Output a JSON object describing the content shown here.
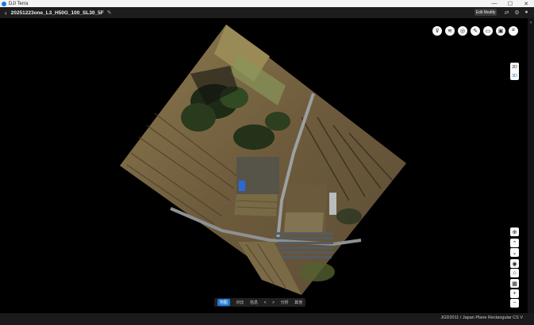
{
  "app": {
    "title": "DJI Terra"
  },
  "window": {
    "minimize": "—",
    "maximize": "☐",
    "close": "✕"
  },
  "project": {
    "name": "20251223one_L3_H50G_100_SL30_5F"
  },
  "header": {
    "edit_button": "Edit Modify"
  },
  "toolbar_icons": [
    "filter-icon",
    "layers-icon",
    "target-icon",
    "pen-icon",
    "ruler-icon",
    "cube-icon",
    "scan-icon"
  ],
  "dim_toggle": {
    "label_2d": "2D",
    "label_3d": "3D"
  },
  "bottom_tabs": [
    {
      "label": "地图",
      "active": true
    },
    {
      "label": "对比",
      "active": false
    },
    {
      "label": "信息",
      "active": false
    },
    {
      "label": "<",
      "active": false
    },
    {
      "label": ">",
      "active": false
    },
    {
      "label": "分析",
      "active": false
    },
    {
      "label": "其他",
      "active": false
    }
  ],
  "status": {
    "crs": "JGD2011 / Japan Plane Rectangular CS V"
  },
  "zoom": {
    "in": "+",
    "out": "−"
  }
}
